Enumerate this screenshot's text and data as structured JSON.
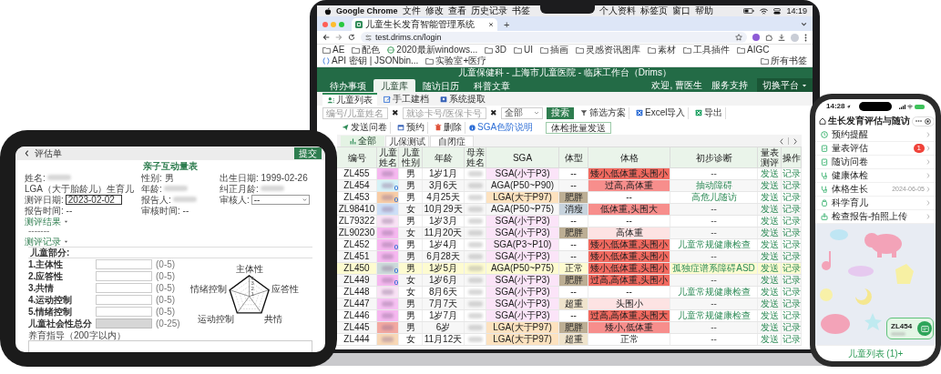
{
  "laptop": {
    "menu_bar": {
      "app": "Google Chrome",
      "menus": [
        "文件",
        "修改",
        "查看",
        "历史记录",
        "书签",
        "个人资料",
        "标签页",
        "窗口",
        "帮助"
      ],
      "clock": "14:19"
    },
    "browser": {
      "tab_title": "儿童生长发育智能管理系统",
      "new_tab": "+",
      "url": "test.drims.cn/login",
      "bookmarks": [
        "AE",
        "配色",
        "2020最新windows...",
        "3D",
        "UI",
        "插画",
        "灵感资讯图库",
        "素材",
        "工具插件",
        "AIGC",
        "API 密钥 | JSONbin...",
        "实验室+医疗"
      ],
      "all_bookmarks": "所有书签"
    },
    "app": {
      "header_title": "儿童保健科 - 上海市儿童医院 - 临床工作台（Drims）",
      "nav": [
        {
          "label": "待办事项",
          "selected": false
        },
        {
          "label": "儿童库",
          "selected": true
        },
        {
          "label": "随访日历",
          "selected": false
        },
        {
          "label": "科普文章",
          "selected": false
        }
      ],
      "greeting": "欢迎, 曹医生",
      "support": "服务支持",
      "switch_platform": "切换平台",
      "subtabs": [
        {
          "label": "儿童列表",
          "selected": true
        },
        {
          "label": "手工建档",
          "selected": false
        },
        {
          "label": "系统提取",
          "selected": false
        }
      ],
      "toolbar": {
        "id_field": {
          "placeholder": "编号/儿童姓名"
        },
        "card_field": {
          "placeholder": "就诊卡号/医保卡号"
        },
        "clear": "✖",
        "filter_select": "全部",
        "search": "搜索",
        "actions": [
          "筛选方案",
          "Excel导入",
          "导出",
          "发送问卷",
          "预约",
          "删除"
        ],
        "sga_help": "SGA色阶说明",
        "batch_send": "体检批量发送"
      },
      "filter_tabs": [
        {
          "label": "全部",
          "selected": true
        },
        {
          "label": "儿保测试",
          "selected": false
        },
        {
          "label": "自闭症",
          "selected": false
        }
      ],
      "table": {
        "columns": [
          "编号",
          "儿童姓名",
          "儿童性别",
          "年龄",
          "母亲姓名",
          "SGA",
          "体型",
          "体格",
          "初步诊断",
          "量表测评",
          "操作"
        ],
        "rows": [
          {
            "id": "ZL455",
            "color": "#f6b8f0",
            "flag": false,
            "sex": "男",
            "age": "1岁1月",
            "sga": {
              "text": "SGA(小于P3)",
              "kind": "sga"
            },
            "build": {
              "text": "--",
              "kind": "none"
            },
            "growth": {
              "text": "矮小,低体重,头围小",
              "kind": "severe"
            },
            "diagnosis": "--",
            "diagnosis_linked": false,
            "scale": "发送",
            "action": "记录",
            "selected": false
          },
          {
            "id": "ZL454",
            "color": "#d6f2f7",
            "flag": true,
            "sex": "男",
            "age": "3月6天",
            "sga": {
              "text": "AGA(P50~P90)",
              "kind": "aga"
            },
            "build": {
              "text": "--",
              "kind": "none"
            },
            "growth": {
              "text": "过高,高体重",
              "kind": "moderate"
            },
            "diagnosis": "抽动障碍",
            "diagnosis_linked": true,
            "scale": "发送",
            "action": "记录",
            "selected": false
          },
          {
            "id": "ZL453",
            "color": "#f8cda6",
            "flag": true,
            "sex": "男",
            "age": "4月25天",
            "sga": {
              "text": "LGA(大于P97)",
              "kind": "lga"
            },
            "build": {
              "text": "肥胖",
              "kind": "obese"
            },
            "growth": {
              "text": "--",
              "kind": "none"
            },
            "diagnosis": "高危儿随访",
            "diagnosis_linked": true,
            "scale": "发送",
            "action": "记录",
            "selected": false
          },
          {
            "id": "ZL98410",
            "color": "#cddff7",
            "flag": false,
            "sex": "女",
            "age": "10月29天",
            "sga": {
              "text": "AGA(P50~P75)",
              "kind": "aga"
            },
            "build": {
              "text": "消瘦",
              "kind": "thin"
            },
            "growth": {
              "text": "低体重,头围大",
              "kind": "moderate"
            },
            "diagnosis": "--",
            "diagnosis_linked": false,
            "scale": "发送",
            "action": "记录",
            "selected": false
          },
          {
            "id": "ZL79322",
            "color": "#f9e2f5",
            "flag": false,
            "sex": "男",
            "age": "1岁3月",
            "sga": {
              "text": "SGA(小于P3)",
              "kind": "sga"
            },
            "build": {
              "text": "--",
              "kind": "none"
            },
            "growth": {
              "text": "--",
              "kind": "none"
            },
            "diagnosis": "--",
            "diagnosis_linked": false,
            "scale": "发送",
            "action": "记录",
            "selected": false
          },
          {
            "id": "ZL90230",
            "color": "#f6b8f0",
            "flag": false,
            "sex": "女",
            "age": "11月20天",
            "sga": {
              "text": "SGA(小于P3)",
              "kind": "sga"
            },
            "build": {
              "text": "肥胖",
              "kind": "obese"
            },
            "growth": {
              "text": "高体重",
              "kind": "mild"
            },
            "diagnosis": "--",
            "diagnosis_linked": false,
            "scale": "发送",
            "action": "记录",
            "selected": false
          },
          {
            "id": "ZL452",
            "color": "#f6b8f0",
            "flag": true,
            "sex": "男",
            "age": "1岁4月",
            "sga": {
              "text": "SGA(P3~P10)",
              "kind": "sga"
            },
            "build": {
              "text": "--",
              "kind": "none"
            },
            "growth": {
              "text": "矮小,低体重,头围小",
              "kind": "severe"
            },
            "diagnosis": "儿童常规健康检查",
            "diagnosis_linked": true,
            "scale": "发送",
            "action": "记录",
            "selected": false
          },
          {
            "id": "ZL451",
            "color": "#f6b8f0",
            "flag": false,
            "sex": "男",
            "age": "6月28天",
            "sga": {
              "text": "SGA(小于P3)",
              "kind": "sga"
            },
            "build": {
              "text": "--",
              "kind": "none"
            },
            "growth": {
              "text": "矮小,低体重,头围小",
              "kind": "severe"
            },
            "diagnosis": "--",
            "diagnosis_linked": false,
            "scale": "发送",
            "action": "记录",
            "selected": false
          },
          {
            "id": "ZL450",
            "color": "#ccdada",
            "flag": true,
            "sex": "男",
            "age": "1岁5月",
            "sga": {
              "text": "AGA(P50~P75)",
              "kind": "aga"
            },
            "build": {
              "text": "正常",
              "kind": "normal"
            },
            "growth": {
              "text": "矮小,低体重,头围小",
              "kind": "severe"
            },
            "diagnosis": "孤独症谱系障碍ASD",
            "diagnosis_linked": true,
            "scale": "发送",
            "action": "记录",
            "selected": true
          },
          {
            "id": "ZL449",
            "color": "#f6b8f0",
            "flag": true,
            "sex": "女",
            "age": "1岁6月",
            "sga": {
              "text": "SGA(小于P3)",
              "kind": "sga"
            },
            "build": {
              "text": "肥胖",
              "kind": "obese"
            },
            "growth": {
              "text": "过高,高体重,头围小",
              "kind": "severe"
            },
            "diagnosis": "--",
            "diagnosis_linked": false,
            "scale": "发送",
            "action": "记录",
            "selected": false
          },
          {
            "id": "ZL448",
            "color": "#f9e2f5",
            "flag": false,
            "sex": "女",
            "age": "8月6天",
            "sga": {
              "text": "SGA(小于P3)",
              "kind": "sga"
            },
            "build": {
              "text": "--",
              "kind": "none"
            },
            "growth": {
              "text": "--",
              "kind": "none"
            },
            "diagnosis": "儿童常规健康检查",
            "diagnosis_linked": true,
            "scale": "发送",
            "action": "记录",
            "selected": false
          },
          {
            "id": "ZL447",
            "color": "#f7c2f3",
            "flag": false,
            "sex": "男",
            "age": "7月7天",
            "sga": {
              "text": "SGA(小于P3)",
              "kind": "sga"
            },
            "build": {
              "text": "超重",
              "kind": "heavy"
            },
            "growth": {
              "text": "头围小",
              "kind": "mild"
            },
            "diagnosis": "--",
            "diagnosis_linked": false,
            "scale": "发送",
            "action": "记录",
            "selected": false
          },
          {
            "id": "ZL446",
            "color": "#f6b8f0",
            "flag": false,
            "sex": "男",
            "age": "1岁7月",
            "sga": {
              "text": "SGA(小于P3)",
              "kind": "sga"
            },
            "build": {
              "text": "--",
              "kind": "none"
            },
            "growth": {
              "text": "过高,高体重,头围大",
              "kind": "severe"
            },
            "diagnosis": "儿童常规健康检查",
            "diagnosis_linked": true,
            "scale": "发送",
            "action": "记录",
            "selected": false
          },
          {
            "id": "ZL445",
            "color": "#f3a9a1",
            "flag": false,
            "sex": "男",
            "age": "6岁",
            "sga": {
              "text": "LGA(大于P97)",
              "kind": "lga"
            },
            "build": {
              "text": "肥胖",
              "kind": "obese"
            },
            "growth": {
              "text": "矮小,低体重",
              "kind": "moderate"
            },
            "diagnosis": "--",
            "diagnosis_linked": false,
            "scale": "发送",
            "action": "记录",
            "selected": false
          },
          {
            "id": "ZL444",
            "color": "#f8d8b6",
            "flag": false,
            "sex": "女",
            "age": "11月12天",
            "sga": {
              "text": "LGA(大于P97)",
              "kind": "lga"
            },
            "build": {
              "text": "超重",
              "kind": "heavy"
            },
            "growth": {
              "text": "正常",
              "kind": "none"
            },
            "diagnosis": "--",
            "diagnosis_linked": false,
            "scale": "发送",
            "action": "记录",
            "selected": false
          }
        ]
      }
    }
  },
  "tablet": {
    "header_title": "评估单",
    "submit": "提交",
    "form_title": "亲子互动量表",
    "info": [
      {
        "kind": "redacted",
        "text": "姓名:"
      },
      {
        "kind": "text",
        "text": "性别: 男"
      },
      {
        "kind": "text",
        "text": "出生日期: 1999-02-26"
      },
      {
        "kind": "text",
        "text": "LGA（大于胎龄儿）生育儿"
      },
      {
        "kind": "redacted",
        "text": "年龄:"
      },
      {
        "kind": "redacted",
        "text": "纠正月龄:"
      },
      {
        "kind": "input",
        "text": "测评日期:",
        "value": "2023-02-02"
      },
      {
        "kind": "redacted",
        "text": "报告人:"
      },
      {
        "kind": "select",
        "text": "审核人:",
        "value": "--"
      },
      {
        "kind": "text",
        "text": "报告时间: --"
      },
      {
        "kind": "text",
        "text": "审核时间: --"
      }
    ],
    "result_toggle": "测评结果",
    "result_text": "-------",
    "record_toggle": "测评记录",
    "child_section": "儿童部分:",
    "scores": [
      {
        "label": "1.主体性",
        "range": "(0-5)",
        "disabled": false
      },
      {
        "label": "2.应答性",
        "range": "(0-5)",
        "disabled": false
      },
      {
        "label": "3.共情",
        "range": "(0-5)",
        "disabled": false
      },
      {
        "label": "4.运动控制",
        "range": "(0-5)",
        "disabled": false
      },
      {
        "label": "5.情绪控制",
        "range": "(0-5)",
        "disabled": false
      },
      {
        "label": "儿童社会性总分",
        "range": "(0-25)",
        "disabled": true
      }
    ],
    "radar": {
      "labels": [
        "主体性",
        "应答性",
        "共情",
        "运动控制",
        "情绪控制"
      ],
      "ticks": [
        "4",
        "3",
        "2",
        "1"
      ]
    },
    "guidance": "养育指导（200字以内）"
  },
  "phone": {
    "time": "14:28",
    "title": "生长发育评估与随访",
    "menu": [
      {
        "label": "预约提醒"
      },
      {
        "label": "量表评估",
        "badge": "1"
      },
      {
        "label": "随访问卷"
      },
      {
        "label": "健康体检"
      },
      {
        "label": "体格生长",
        "date": "2024-06-05"
      },
      {
        "label": "科学育儿"
      },
      {
        "label": "检查报告-拍照上传"
      }
    ],
    "card_id": "ZL454",
    "bottom": "儿童列表 (1)+"
  }
}
